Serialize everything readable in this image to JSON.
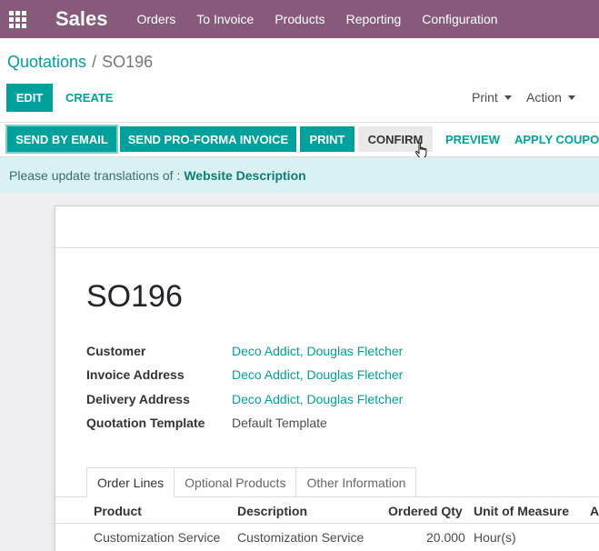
{
  "navbar": {
    "app_name": "Sales",
    "menu": [
      "Orders",
      "To Invoice",
      "Products",
      "Reporting",
      "Configuration"
    ],
    "background": "#875a7b"
  },
  "breadcrumb": {
    "parent": "Quotations",
    "separator": "/",
    "current": "SO196"
  },
  "toolbar": {
    "edit_label": "EDIT",
    "create_label": "CREATE",
    "print_label": "Print",
    "action_label": "Action"
  },
  "statusbar": {
    "send_by_email": "SEND BY EMAIL",
    "send_proforma": "SEND PRO-FORMA INVOICE",
    "print": "PRINT",
    "confirm": "CONFIRM",
    "preview": "PREVIEW",
    "apply_coupon": "APPLY COUPO"
  },
  "alert": {
    "text": "Please update translations of :",
    "link": "Website Description"
  },
  "record": {
    "name": "SO196",
    "fields": [
      {
        "label": "Customer",
        "value": "Deco Addict, Douglas Fletcher",
        "is_link": true
      },
      {
        "label": "Invoice Address",
        "value": "Deco Addict, Douglas Fletcher",
        "is_link": true
      },
      {
        "label": "Delivery Address",
        "value": "Deco Addict, Douglas Fletcher",
        "is_link": true
      },
      {
        "label": "Quotation Template",
        "value": "Default Template",
        "is_link": false
      }
    ]
  },
  "tabs": [
    "Order Lines",
    "Optional Products",
    "Other Information"
  ],
  "order_lines": {
    "columns": [
      "Product",
      "Description",
      "Ordered Qty",
      "Unit of Measure",
      "A"
    ],
    "rows": [
      {
        "product": "Customization Service",
        "description": "Customization Service",
        "qty": "20.000",
        "uom": "Hour(s)"
      }
    ]
  },
  "colors": {
    "accent": "#00a09d",
    "alert_bg": "#d9f2f1"
  }
}
